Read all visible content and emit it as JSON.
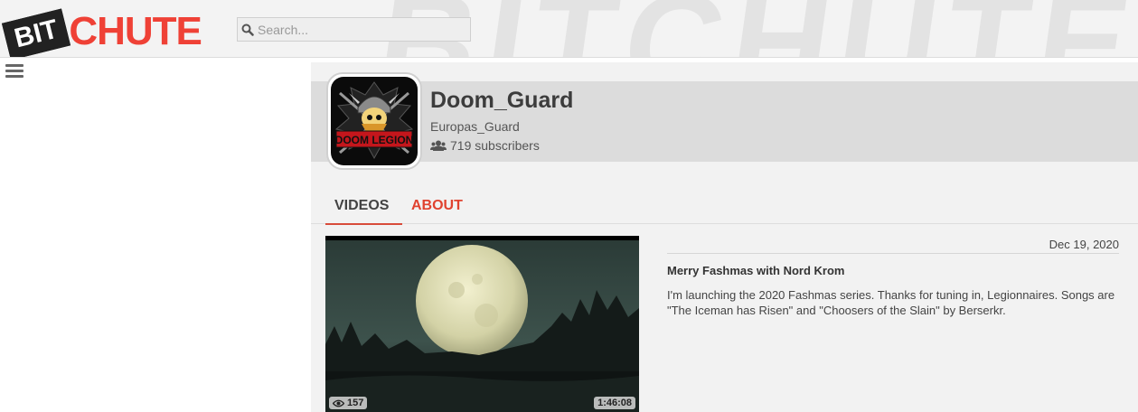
{
  "header": {
    "logo_left": "BIT",
    "logo_right": "CHUTE",
    "watermark": "BITCHUTE",
    "search_placeholder": "Search..."
  },
  "channel": {
    "name": "Doom_Guard",
    "owner": "Europas_Guard",
    "subscribers": "719 subscribers",
    "avatar_text": "DOOM LEGION"
  },
  "tabs": {
    "videos": "VIDEOS",
    "about": "ABOUT"
  },
  "video": {
    "date": "Dec 19, 2020",
    "title": "Merry Fashmas with Nord Krom",
    "description": "I'm launching the 2020 Fashmas series. Thanks for tuning in, Legionnaires. Songs are \"The Iceman has Risen\" and \"Choosers of the Slain\" by Berserkr.",
    "views": "157",
    "duration": "1:46:08"
  },
  "colors": {
    "accent": "#ef4136",
    "tab_active_underline": "#d84b3a",
    "header_band": "#dcdcdc",
    "panel_bg": "#f2f2f2"
  }
}
